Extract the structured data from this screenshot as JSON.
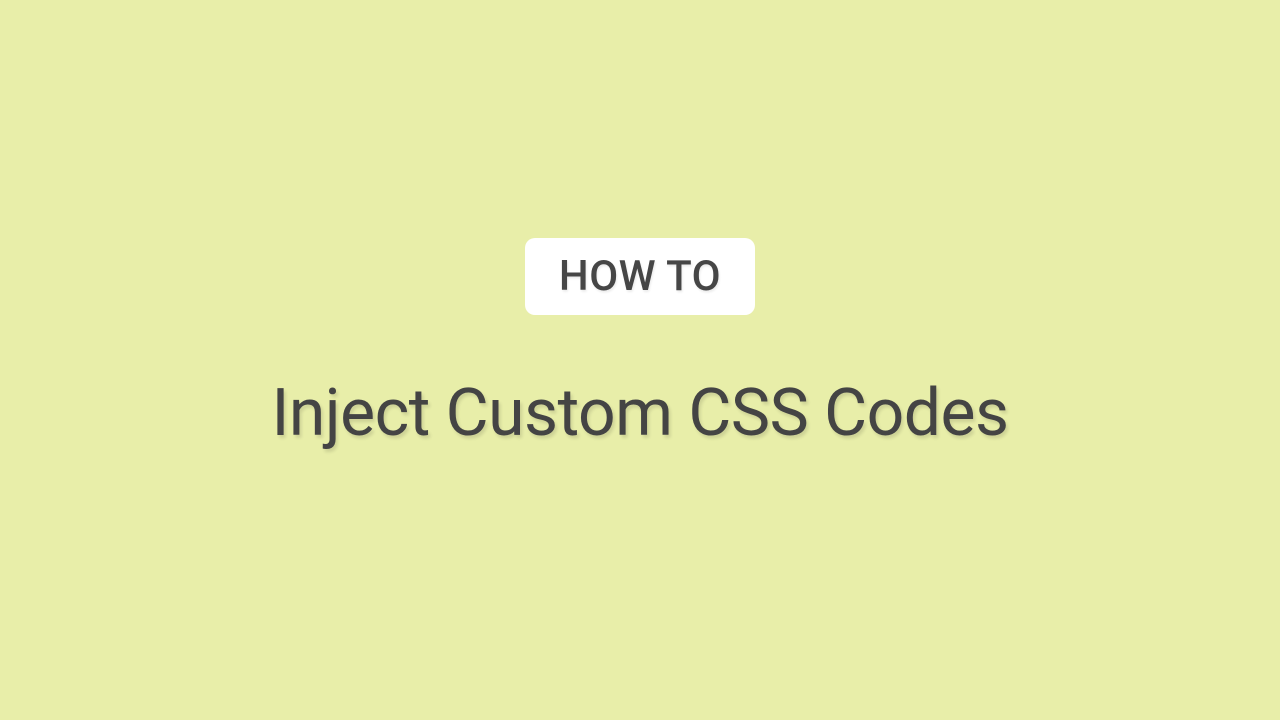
{
  "badge": {
    "label": "HOW TO"
  },
  "title": "Inject Custom CSS Codes"
}
